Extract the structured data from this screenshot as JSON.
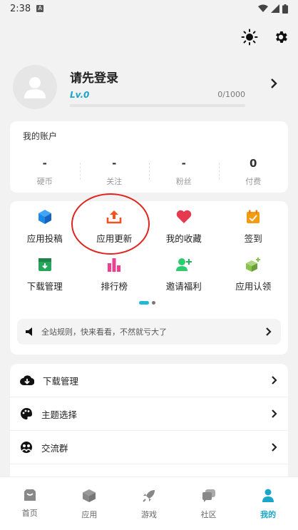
{
  "status_bar": {
    "time": "2:38",
    "notification_icon": "A"
  },
  "top_actions": {
    "theme_icon": "sun-icon",
    "settings_icon": "gear-icon"
  },
  "profile": {
    "name": "请先登录",
    "level": "Lv.0",
    "exp": "0/1000"
  },
  "account": {
    "title": "我的账户",
    "stats": [
      {
        "value": "-",
        "label": "硬币"
      },
      {
        "value": "-",
        "label": "关注"
      },
      {
        "value": "-",
        "label": "粉丝"
      },
      {
        "value": "0",
        "label": "付费"
      }
    ]
  },
  "features": {
    "items": [
      {
        "label": "应用投稿",
        "icon": "cube-icon",
        "color": "#1e88e5"
      },
      {
        "label": "应用更新",
        "icon": "upload-icon",
        "color": "#f4511e"
      },
      {
        "label": "我的收藏",
        "icon": "heart-icon",
        "color": "#e53950"
      },
      {
        "label": "签到",
        "icon": "calendar-check-icon",
        "color": "#f39c12"
      },
      {
        "label": "下载管理",
        "icon": "download-box-icon",
        "color": "#26a65b"
      },
      {
        "label": "排行榜",
        "icon": "bar-chart-icon",
        "color": "#e84393"
      },
      {
        "label": "邀请福利",
        "icon": "add-user-icon",
        "color": "#2ecc71"
      },
      {
        "label": "应用认领",
        "icon": "cube-plus-icon",
        "color": "#8bc34a"
      }
    ],
    "notice": "全站规则，快来看看，不然就亏大了"
  },
  "menu": {
    "items": [
      {
        "label": "下载管理",
        "icon": "cloud-download-icon"
      },
      {
        "label": "主题选择",
        "icon": "palette-icon"
      },
      {
        "label": "交流群",
        "icon": "group-icon"
      }
    ]
  },
  "tabs": [
    {
      "label": "首页",
      "icon": "home-icon"
    },
    {
      "label": "应用",
      "icon": "box-icon"
    },
    {
      "label": "游戏",
      "icon": "rocket-icon"
    },
    {
      "label": "社区",
      "icon": "chat-icon"
    },
    {
      "label": "我的",
      "icon": "person-icon"
    }
  ],
  "colors": {
    "accent": "#1aa6c9",
    "highlight": "#e0251f"
  }
}
